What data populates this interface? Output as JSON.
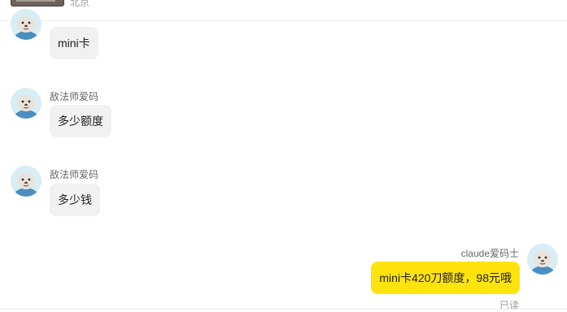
{
  "header": {
    "location": "北京"
  },
  "messages": [
    {
      "sender": "",
      "text": "mini卡",
      "mine": false
    },
    {
      "sender": "敌法师爱码",
      "text": "多少额度",
      "mine": false
    },
    {
      "sender": "敌法师爱码",
      "text": "多少钱",
      "mine": false
    },
    {
      "sender": "claude爱码士",
      "text": "mini卡420刀额度，98元哦",
      "mine": true,
      "status": "已读"
    }
  ],
  "colors": {
    "my_bubble": "#ffe30f",
    "other_bubble": "#f1f1f1"
  },
  "icons": {
    "avatar": "seal-avatar-icon"
  }
}
